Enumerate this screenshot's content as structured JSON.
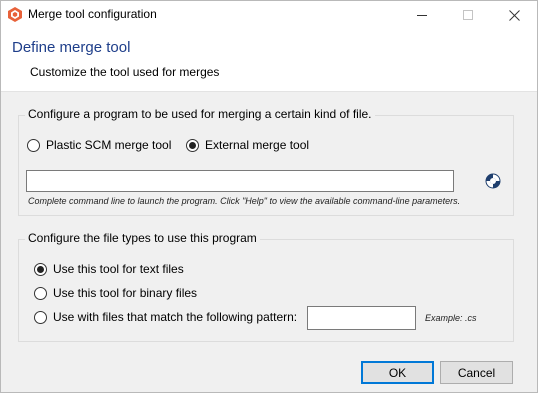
{
  "window": {
    "title": "Merge tool configuration",
    "brand_color": "#e8623a"
  },
  "header": {
    "title": "Define merge tool",
    "subtitle": "Customize the tool used for merges"
  },
  "program_group": {
    "title": "Configure a program to be used for merging a certain kind of file.",
    "options": [
      {
        "label": "Plastic SCM merge tool",
        "selected": false
      },
      {
        "label": "External merge tool",
        "selected": true
      }
    ],
    "command_line_value": "",
    "hint": "Complete command line to launch the program. Click \"Help\" to view the available command-line parameters."
  },
  "filetypes_group": {
    "title": "Configure the file types to use this program",
    "options": [
      {
        "label": "Use this tool for text files",
        "selected": true
      },
      {
        "label": "Use this tool for binary files",
        "selected": false
      },
      {
        "label": "Use with files that match the following pattern:",
        "selected": false
      }
    ],
    "pattern_value": "",
    "example": "Example: .cs"
  },
  "footer": {
    "ok_label": "OK",
    "cancel_label": "Cancel"
  }
}
